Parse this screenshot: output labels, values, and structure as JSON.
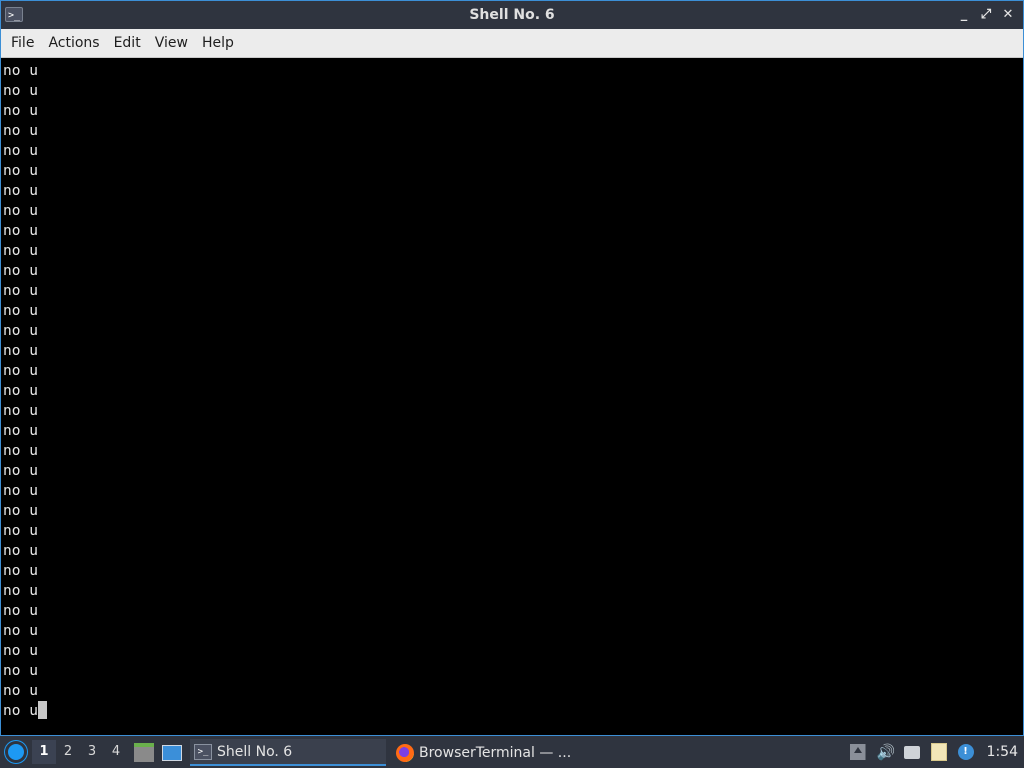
{
  "window": {
    "title": "Shell No. 6",
    "app_icon": "terminal-icon",
    "controls": {
      "minimize": "_",
      "maximize": "⤢",
      "close": "✕"
    }
  },
  "menubar": {
    "items": [
      "File",
      "Actions",
      "Edit",
      "View",
      "Help"
    ]
  },
  "terminal": {
    "lines": [
      "no u",
      "no u",
      "no u",
      "no u",
      "no u",
      "no u",
      "no u",
      "no u",
      "no u",
      "no u",
      "no u",
      "no u",
      "no u",
      "no u",
      "no u",
      "no u",
      "no u",
      "no u",
      "no u",
      "no u",
      "no u",
      "no u",
      "no u",
      "no u",
      "no u",
      "no u",
      "no u",
      "no u",
      "no u",
      "no u",
      "no u",
      "no u"
    ],
    "prompt_line": "no u",
    "colors": {
      "background": "#000000",
      "foreground": "#e8e8e8"
    }
  },
  "taskbar": {
    "start_icon": "app-menu-icon",
    "desktops": [
      "1",
      "2",
      "3",
      "4"
    ],
    "active_desktop": "1",
    "launchers": [
      "file-manager-icon",
      "show-desktop-icon"
    ],
    "tasks": [
      {
        "label": "Shell No. 6",
        "icon": "terminal-icon",
        "active": true
      },
      {
        "label": "BrowserTerminal — ...",
        "icon": "firefox-icon",
        "active": false
      }
    ],
    "tray_icons": [
      "tray-expand-icon",
      "volume-icon",
      "network-icon",
      "clipboard-icon",
      "notification-icon"
    ],
    "volume_glyph": "🔊",
    "notification_glyph": "!",
    "clock": "1:54"
  },
  "accent_color": "#3c8fd6"
}
